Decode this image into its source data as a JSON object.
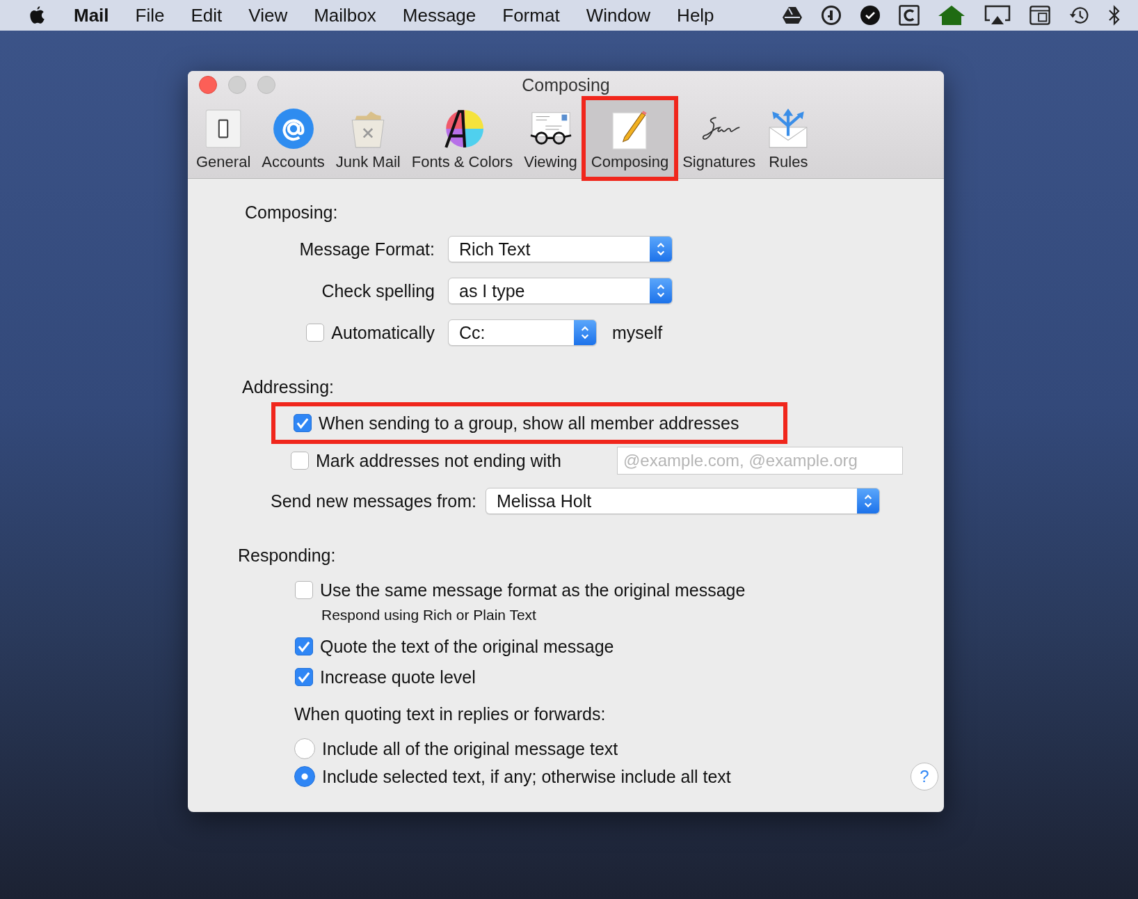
{
  "menu_bar": {
    "app": "Mail",
    "items": [
      "File",
      "Edit",
      "View",
      "Mailbox",
      "Message",
      "Format",
      "Window",
      "Help"
    ],
    "status_icons": [
      {
        "kind": "drive"
      },
      {
        "kind": "key"
      },
      {
        "kind": "check"
      },
      {
        "kind": "letter-box"
      },
      {
        "kind": "house"
      },
      {
        "kind": "airplay"
      },
      {
        "kind": "keyboard"
      },
      {
        "kind": "clock"
      },
      {
        "kind": "bluetooth"
      }
    ]
  },
  "window": {
    "title": "Composing"
  },
  "toolbar": [
    {
      "label": "General",
      "kind": "general",
      "selected": false,
      "highlighted": false
    },
    {
      "label": "Accounts",
      "kind": "accounts",
      "selected": false,
      "highlighted": false
    },
    {
      "label": "Junk Mail",
      "kind": "junk",
      "selected": false,
      "highlighted": false
    },
    {
      "label": "Fonts & Colors",
      "kind": "fonts",
      "selected": false,
      "highlighted": false
    },
    {
      "label": "Viewing",
      "kind": "viewing",
      "selected": false,
      "highlighted": false
    },
    {
      "label": "Composing",
      "kind": "composing",
      "selected": true,
      "highlighted": true
    },
    {
      "label": "Signatures",
      "kind": "signatures",
      "selected": false,
      "highlighted": false
    },
    {
      "label": "Rules",
      "kind": "rules",
      "selected": false,
      "highlighted": false
    }
  ],
  "composing": {
    "heading": "Composing:",
    "message_format": {
      "label": "Message Format:",
      "value": "Rich Text"
    },
    "check_spelling": {
      "label": "Check spelling",
      "value": "as I type"
    },
    "auto_cc": {
      "label": "Automatically",
      "checked": false,
      "value": "Cc:",
      "suffix": "myself"
    }
  },
  "addressing": {
    "heading": "Addressing:",
    "show_members": {
      "label": "When sending to a group, show all member addresses",
      "checked": true,
      "highlighted": true
    },
    "mark_addresses": {
      "label": "Mark addresses not ending with",
      "checked": false,
      "placeholder": "@example.com, @example.org"
    },
    "send_from": {
      "label": "Send new messages from:",
      "value": "Melissa Holt"
    }
  },
  "responding": {
    "heading": "Responding:",
    "options": [
      {
        "label": "Use the same message format as the original message",
        "checked": false,
        "note": "Respond using Rich or Plain Text"
      },
      {
        "label": "Quote the text of the original message",
        "checked": true
      },
      {
        "label": "Increase quote level",
        "checked": true
      }
    ],
    "quoting": {
      "label": "When quoting text in replies or forwards:",
      "choices": [
        {
          "label": "Include all of the original message text",
          "selected": false
        },
        {
          "label": "Include selected text, if any; otherwise include all text",
          "selected": true
        }
      ]
    },
    "help_button": "?"
  }
}
